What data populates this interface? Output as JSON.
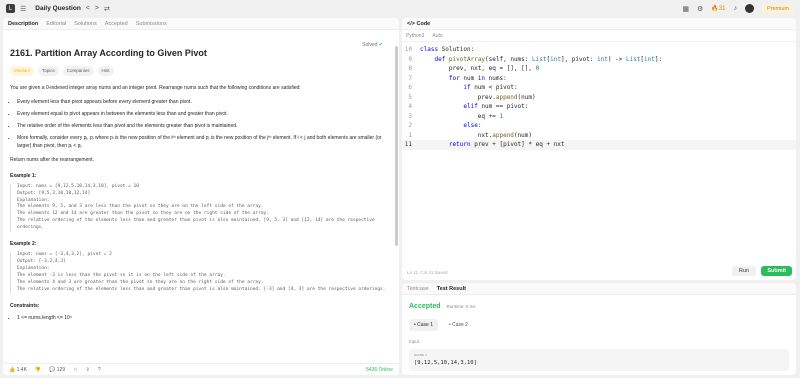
{
  "topbar": {
    "title": "Daily Question",
    "prev": "<",
    "next": ">",
    "shuffle": "⇄",
    "streak": "31",
    "premium": "Premium"
  },
  "left_tabs": [
    "Description",
    "Editorial",
    "Solutions",
    "Accepted",
    "Submissions"
  ],
  "problem": {
    "title": "2161. Partition Array According to Given Pivot",
    "status": "Solved",
    "difficulty": "Medium",
    "tags": [
      "Topics",
      "Companies",
      "Hint"
    ],
    "intro": "You are given a 0-indexed integer array nums and an integer pivot. Rearrange nums such that the following conditions are satisfied:",
    "b1": "Every element less than pivot appears before every element greater than pivot.",
    "b2": "Every element equal to pivot appears in between the elements less than and greater than pivot.",
    "b3": "The relative order of the elements less than pivot and the elements greater than pivot is maintained.",
    "b3a": "More formally, consider every pᵢ, pⱼ where pᵢ is the new position of the iᵗʰ element and pⱼ is the new position of the jᵗʰ element. If i < j",
    "b3b": "and both elements are smaller (or larger) than pivot, then pᵢ < pⱼ.",
    "ret": "Return nums after the rearrangement.",
    "ex1_title": "Example 1:",
    "ex1": "Input: nums = [9,12,5,10,14,3,10], pivot = 10\nOutput: [9,5,3,10,10,12,14]\nExplanation:\nThe elements 9, 5, and 3 are less than the pivot so they are on the left side of the array.\nThe elements 12 and 14 are greater than the pivot so they are on the right side of the array.\nThe relative ordering of the elements less than and greater than pivot is also maintained. [9, 5, 3] and [12, 14] are the respective orderings.",
    "ex2_title": "Example 2:",
    "ex2": "Input: nums = [-3,4,3,2], pivot = 2\nOutput: [-3,2,4,3]\nExplanation:\nThe element -3 is less than the pivot so it is on the left side of the array.\nThe elements 4 and 3 are greater than the pivot so they are on the right side of the array.\nThe relative ordering of the elements less than and greater than pivot is also maintained. [-3] and [4, 3] are the respective orderings.",
    "constraints_title": "Constraints:",
    "c1": "1 <= nums.length <= 10⁵"
  },
  "footer": {
    "likes": "1.4K",
    "comments": "129",
    "online": "5436 Online"
  },
  "code_panel": {
    "tab": "Code",
    "lang": "Python3",
    "mode": "Auto",
    "status": "Ln 11, Col 41    Saved",
    "run": "Run",
    "submit": "Submit"
  },
  "code_lines": [
    {
      "n": "10",
      "t": "class Solution:"
    },
    {
      "n": "9",
      "t": "    def pivotArray(self, nums: List[int], pivot: int) -> List[int]:"
    },
    {
      "n": "8",
      "t": "        prev, nxt, eq = [], [], 0"
    },
    {
      "n": "7",
      "t": "        for num in nums:"
    },
    {
      "n": "6",
      "t": "            if num < pivot:"
    },
    {
      "n": "5",
      "t": "                prev.append(num)"
    },
    {
      "n": "4",
      "t": "            elif num == pivot:"
    },
    {
      "n": "3",
      "t": "                eq += 1"
    },
    {
      "n": "2",
      "t": "            else:"
    },
    {
      "n": "1",
      "t": "                nxt.append(num)"
    },
    {
      "n": "11",
      "t": "        return prev + [pivot] * eq + nxt"
    }
  ],
  "result": {
    "tab1": "Testcase",
    "tab2": "Test Result",
    "verdict": "Accepted",
    "runtime": "Runtime: 0 ms",
    "case1": "• Case 1",
    "case2": "• Case 2",
    "input_label": "Input",
    "var": "nums =",
    "value": "[9,12,5,10,14,3,10]"
  }
}
